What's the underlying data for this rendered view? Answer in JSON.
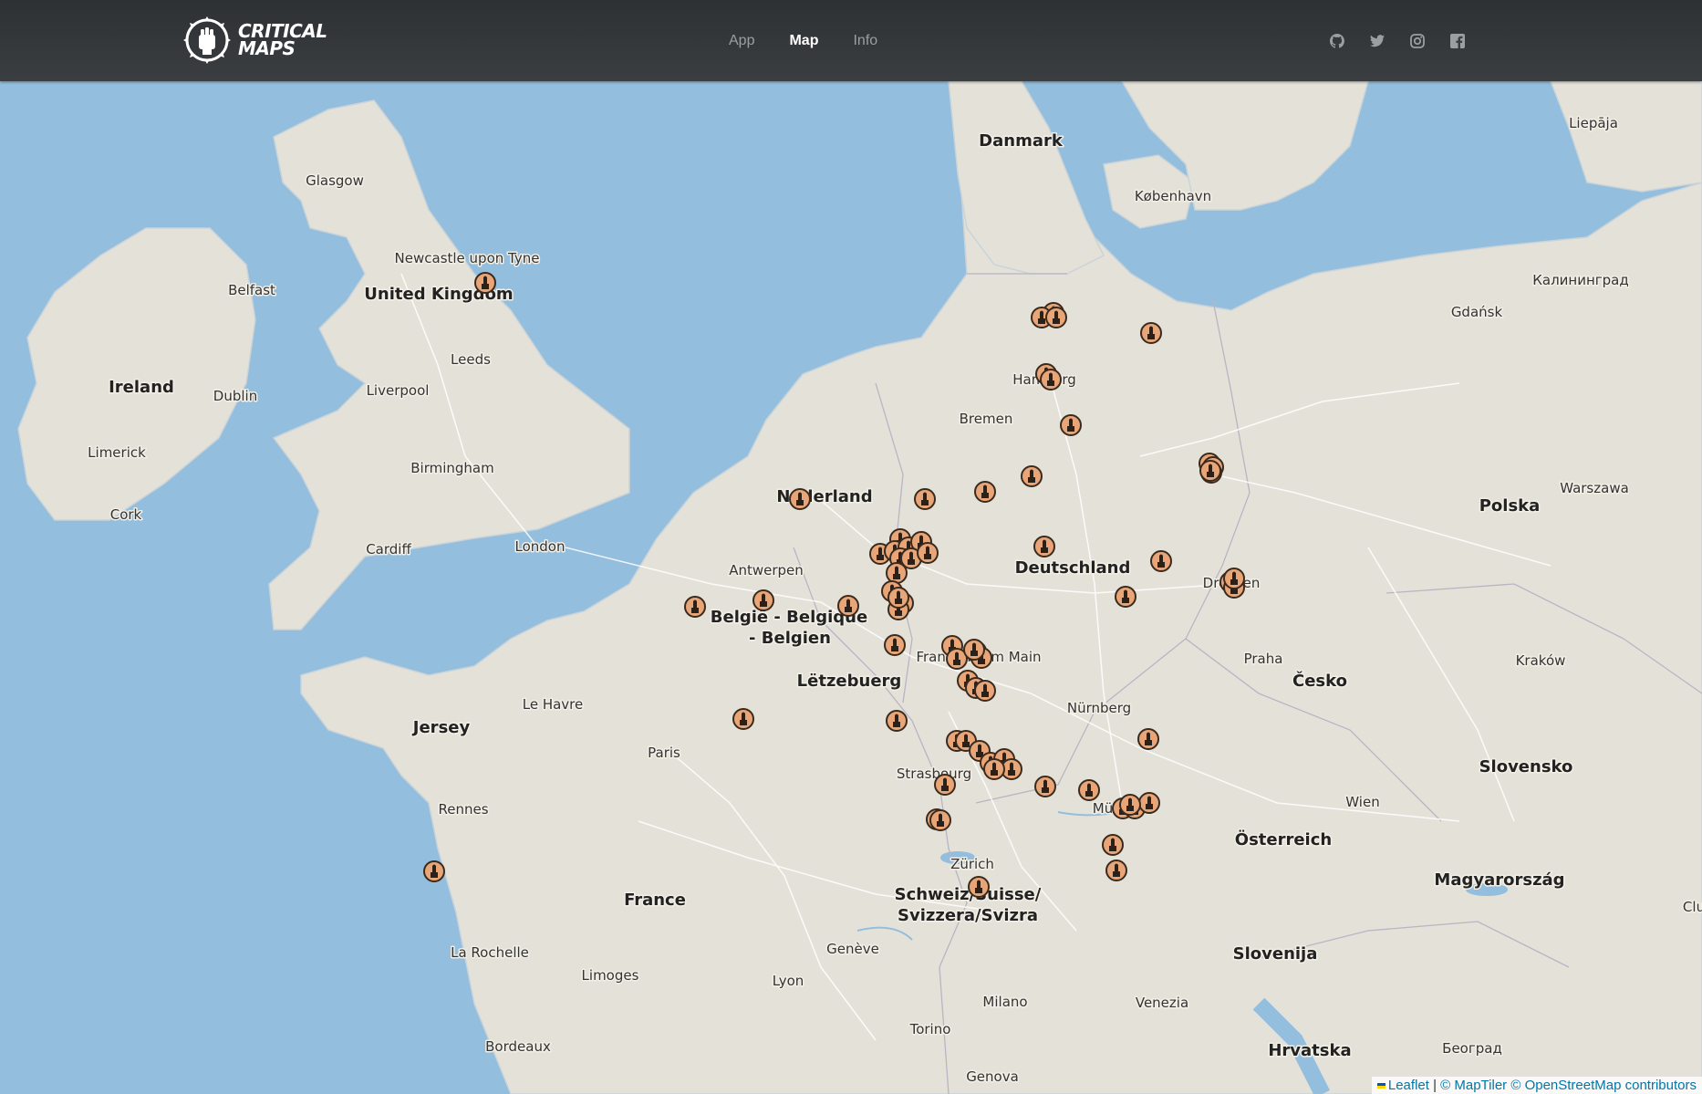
{
  "nav": {
    "logo_line1": "CRITICAL",
    "logo_line2": "MAPS",
    "links": [
      {
        "label": "App",
        "active": false
      },
      {
        "label": "Map",
        "active": true
      },
      {
        "label": "Info",
        "active": false
      }
    ],
    "social_icons": [
      "github-icon",
      "twitter-icon",
      "instagram-icon",
      "facebook-icon"
    ]
  },
  "map": {
    "countries": [
      {
        "name": "Danmark"
      },
      {
        "name": "United Kingdom"
      },
      {
        "name": "Ireland"
      },
      {
        "name": "Nederland"
      },
      {
        "name": "België - Belgique"
      },
      {
        "name": "- Belgien"
      },
      {
        "name": "Deutschland"
      },
      {
        "name": "Polska"
      },
      {
        "name": "Lëtzebuerg"
      },
      {
        "name": "Česko"
      },
      {
        "name": "Jersey"
      },
      {
        "name": "Slovensko"
      },
      {
        "name": "Österreich"
      },
      {
        "name": "Magyarország"
      },
      {
        "name": "France"
      },
      {
        "name": "Schweiz/Suisse/"
      },
      {
        "name": "Svizzera/Svizra"
      },
      {
        "name": "Slovenija"
      },
      {
        "name": "Hrvatska"
      }
    ],
    "cities": [
      {
        "name": "Liepāja"
      },
      {
        "name": "Glasgow"
      },
      {
        "name": "København"
      },
      {
        "name": "Newcastle upon Tyne"
      },
      {
        "name": "Belfast"
      },
      {
        "name": "Калининград"
      },
      {
        "name": "Gdańsk"
      },
      {
        "name": "Leeds"
      },
      {
        "name": "Liverpool"
      },
      {
        "name": "Dublin"
      },
      {
        "name": "Hamburg"
      },
      {
        "name": "Bremen"
      },
      {
        "name": "Limerick"
      },
      {
        "name": "Birmingham"
      },
      {
        "name": "Warszawa"
      },
      {
        "name": "Cork"
      },
      {
        "name": "Cardiff"
      },
      {
        "name": "London"
      },
      {
        "name": "Antwerpen"
      },
      {
        "name": "Dresden"
      },
      {
        "name": "Frankfurt am Main"
      },
      {
        "name": "Praha"
      },
      {
        "name": "Kraków"
      },
      {
        "name": "Le Havre"
      },
      {
        "name": "Nürnberg"
      },
      {
        "name": "Paris"
      },
      {
        "name": "Strasbourg"
      },
      {
        "name": "Rennes"
      },
      {
        "name": "Wien"
      },
      {
        "name": "München"
      },
      {
        "name": "Zürich"
      },
      {
        "name": "Genève"
      },
      {
        "name": "La Rochelle"
      },
      {
        "name": "Limoges"
      },
      {
        "name": "Lyon"
      },
      {
        "name": "Milano"
      },
      {
        "name": "Venezia"
      },
      {
        "name": "Torino"
      },
      {
        "name": "Bordeaux"
      },
      {
        "name": "Београд"
      },
      {
        "name": "Genova"
      },
      {
        "name": "Clu"
      }
    ],
    "marker_count": 70
  },
  "attribution": {
    "leaflet": "Leaflet",
    "separator": " | ",
    "maptiler": "© MapTiler",
    "osm": "© OpenStreetMap contributors"
  }
}
